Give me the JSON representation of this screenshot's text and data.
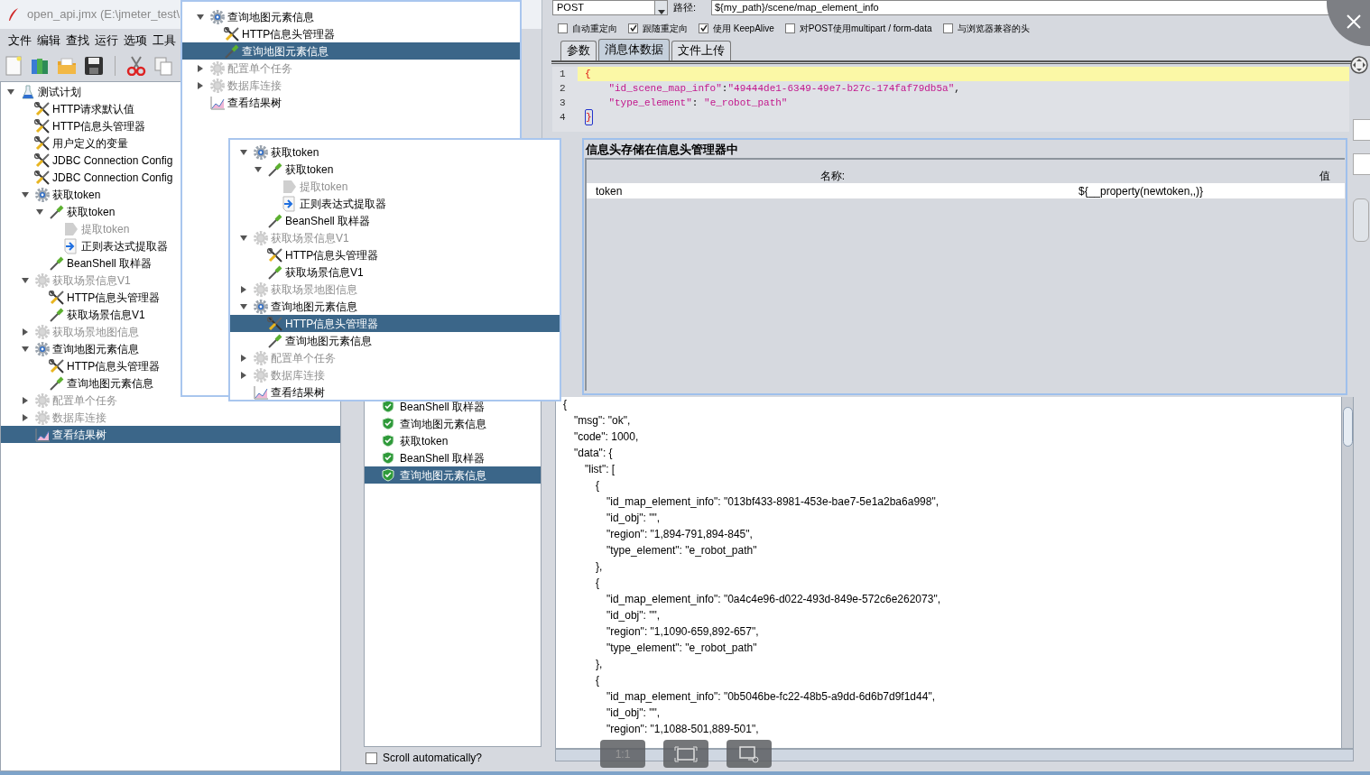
{
  "window": {
    "title": "open_api.jmx (E:\\jmeter_test\\"
  },
  "menu": [
    "文件",
    "编辑",
    "查找",
    "运行",
    "选项",
    "工具"
  ],
  "left_tree": [
    {
      "label": "测试计划",
      "kind": "plan",
      "expanded": true,
      "selected": false,
      "disabled": false,
      "children": [
        {
          "label": "HTTP请求默认值",
          "kind": "config",
          "selected": false,
          "disabled": false
        },
        {
          "label": "HTTP信息头管理器",
          "kind": "config",
          "selected": false,
          "disabled": false
        },
        {
          "label": "用户定义的变量",
          "kind": "config",
          "selected": false,
          "disabled": false
        },
        {
          "label": "JDBC Connection Config",
          "kind": "config",
          "selected": false,
          "disabled": false
        },
        {
          "label": "JDBC Connection Config",
          "kind": "config",
          "selected": false,
          "disabled": false
        },
        {
          "label": "获取token",
          "kind": "thread_group",
          "expanded": true,
          "selected": false,
          "disabled": false,
          "children": [
            {
              "label": "获取token",
              "kind": "sampler",
              "expanded": true,
              "selected": false,
              "disabled": false,
              "children": [
                {
                  "label": "提取token",
                  "kind": "extractor",
                  "selected": false,
                  "disabled": true
                },
                {
                  "label": "正则表达式提取器",
                  "kind": "regex",
                  "selected": false,
                  "disabled": false
                }
              ]
            },
            {
              "label": "BeanShell 取样器",
              "kind": "sampler",
              "selected": false,
              "disabled": false
            }
          ]
        },
        {
          "label": "获取场景信息V1",
          "kind": "thread_group",
          "expanded": true,
          "selected": false,
          "disabled": true,
          "children": [
            {
              "label": "HTTP信息头管理器",
              "kind": "config",
              "selected": false,
              "disabled": false
            },
            {
              "label": "获取场景信息V1",
              "kind": "sampler",
              "selected": false,
              "disabled": false
            }
          ]
        },
        {
          "label": "获取场景地图信息",
          "kind": "thread_group",
          "expanded": false,
          "selected": false,
          "disabled": true
        },
        {
          "label": "查询地图元素信息",
          "kind": "thread_group",
          "expanded": true,
          "selected": false,
          "disabled": false,
          "children": [
            {
              "label": "HTTP信息头管理器",
              "kind": "config",
              "selected": false,
              "disabled": false
            },
            {
              "label": "查询地图元素信息",
              "kind": "sampler",
              "selected": false,
              "disabled": false
            }
          ]
        },
        {
          "label": "配置单个任务",
          "kind": "thread_group",
          "expanded": false,
          "selected": false,
          "disabled": true
        },
        {
          "label": "数据库连接",
          "kind": "thread_group",
          "expanded": false,
          "selected": false,
          "disabled": true
        },
        {
          "label": "查看结果树",
          "kind": "listener",
          "selected": true,
          "disabled": false
        }
      ]
    }
  ],
  "popup_tree_top": [
    {
      "label": "查询地图元素信息",
      "kind": "thread_group",
      "expanded": true,
      "selected": false,
      "disabled": false,
      "children": [
        {
          "label": "HTTP信息头管理器",
          "kind": "config",
          "selected": false,
          "disabled": false
        },
        {
          "label": "查询地图元素信息",
          "kind": "sampler",
          "selected": true,
          "disabled": false
        }
      ]
    },
    {
      "label": "配置单个任务",
      "kind": "thread_group",
      "expanded": false,
      "selected": false,
      "disabled": true
    },
    {
      "label": "数据库连接",
      "kind": "thread_group",
      "expanded": false,
      "selected": false,
      "disabled": true
    },
    {
      "label": "查看结果树",
      "kind": "listener",
      "selected": false,
      "disabled": false
    }
  ],
  "popup_tree": [
    {
      "label": "获取token",
      "kind": "thread_group",
      "expanded": true,
      "selected": false,
      "disabled": false,
      "children": [
        {
          "label": "获取token",
          "kind": "sampler",
          "expanded": true,
          "selected": false,
          "disabled": false,
          "children": [
            {
              "label": "提取token",
              "kind": "extractor",
              "selected": false,
              "disabled": true
            },
            {
              "label": "正则表达式提取器",
              "kind": "regex",
              "selected": false,
              "disabled": false
            }
          ]
        },
        {
          "label": "BeanShell 取样器",
          "kind": "sampler",
          "selected": false,
          "disabled": false
        }
      ]
    },
    {
      "label": "获取场景信息V1",
      "kind": "thread_group",
      "expanded": true,
      "selected": false,
      "disabled": true,
      "children": [
        {
          "label": "HTTP信息头管理器",
          "kind": "config",
          "selected": false,
          "disabled": false
        },
        {
          "label": "获取场景信息V1",
          "kind": "sampler",
          "selected": false,
          "disabled": false
        }
      ]
    },
    {
      "label": "获取场景地图信息",
      "kind": "thread_group",
      "expanded": false,
      "selected": false,
      "disabled": true
    },
    {
      "label": "查询地图元素信息",
      "kind": "thread_group",
      "expanded": true,
      "selected": false,
      "disabled": false,
      "children": [
        {
          "label": "HTTP信息头管理器",
          "kind": "config",
          "selected": true,
          "disabled": false
        },
        {
          "label": "查询地图元素信息",
          "kind": "sampler",
          "selected": false,
          "disabled": false
        }
      ]
    },
    {
      "label": "配置单个任务",
      "kind": "thread_group",
      "expanded": false,
      "selected": false,
      "disabled": true
    },
    {
      "label": "数据库连接",
      "kind": "thread_group",
      "expanded": false,
      "selected": false,
      "disabled": true
    },
    {
      "label": "查看结果树",
      "kind": "listener",
      "selected": false,
      "disabled": false
    }
  ],
  "request": {
    "method": "POST",
    "path_label": "路径:",
    "path": "${my_path}/scene/map_element_info",
    "options": [
      {
        "label": "自动重定向",
        "checked": false
      },
      {
        "label": "跟随重定向",
        "checked": true
      },
      {
        "label": "使用 KeepAlive",
        "checked": true
      },
      {
        "label": "对POST使用multipart / form-data",
        "checked": false
      },
      {
        "label": "与浏览器兼容的头",
        "checked": false
      }
    ],
    "tabs": [
      {
        "label": "参数",
        "selected": false
      },
      {
        "label": "消息体数据",
        "selected": true
      },
      {
        "label": "文件上传",
        "selected": false
      }
    ],
    "body_lines": [
      {
        "number": "1",
        "text": "{",
        "current": true,
        "matched": false
      },
      {
        "number": "2",
        "text": "    \"id_scene_map_info\":\"49444de1-6349-49e7-b27c-174faf79db5a\",",
        "current": false,
        "matched": false
      },
      {
        "number": "3",
        "text": "    \"type_element\": \"e_robot_path\"",
        "current": false,
        "matched": false
      },
      {
        "number": "4",
        "text": "}",
        "current": false,
        "matched": true
      }
    ]
  },
  "header_manager": {
    "title": "信息头存储在信息头管理器中",
    "columns": [
      "名称:",
      "值"
    ],
    "rows": [
      [
        "token",
        "${__property(newtoken,,)}"
      ]
    ]
  },
  "results": {
    "items": [
      {
        "label": "BeanShell 取样器",
        "selected": false
      },
      {
        "label": "查询地图元素信息",
        "selected": false
      },
      {
        "label": "获取token",
        "selected": false
      },
      {
        "label": "BeanShell 取样器",
        "selected": false
      },
      {
        "label": "查询地图元素信息",
        "selected": true
      }
    ],
    "scroll_automatically": {
      "label": "Scroll automatically?",
      "checked": false
    },
    "response_lines": [
      "{",
      "  \"msg\": \"ok\",",
      "  \"code\": 1000,",
      "  \"data\": {",
      "    \"list\": [",
      "      {",
      "        \"id_map_element_info\": \"013bf433-8981-453e-bae7-5e1a2ba6a998\",",
      "        \"id_obj\": \"\",",
      "        \"region\": \"1,894-791,894-845\",",
      "        \"type_element\": \"e_robot_path\"",
      "      },",
      "      {",
      "        \"id_map_element_info\": \"0a4c4e96-d022-493d-849e-572c6e262073\",",
      "        \"id_obj\": \"\",",
      "        \"region\": \"1,1090-659,892-657\",",
      "        \"type_element\": \"e_robot_path\"",
      "      },",
      "      {",
      "        \"id_map_element_info\": \"0b5046be-fc22-48b5-a9dd-6d6b7d9f1d44\",",
      "        \"id_obj\": \"\",",
      "        \"region\": \"1,1088-501,889-501\","
    ]
  },
  "viewer_buttons": [
    {
      "kind": "actual_size",
      "label": "1:1"
    },
    {
      "kind": "fit"
    },
    {
      "kind": "crop"
    }
  ]
}
